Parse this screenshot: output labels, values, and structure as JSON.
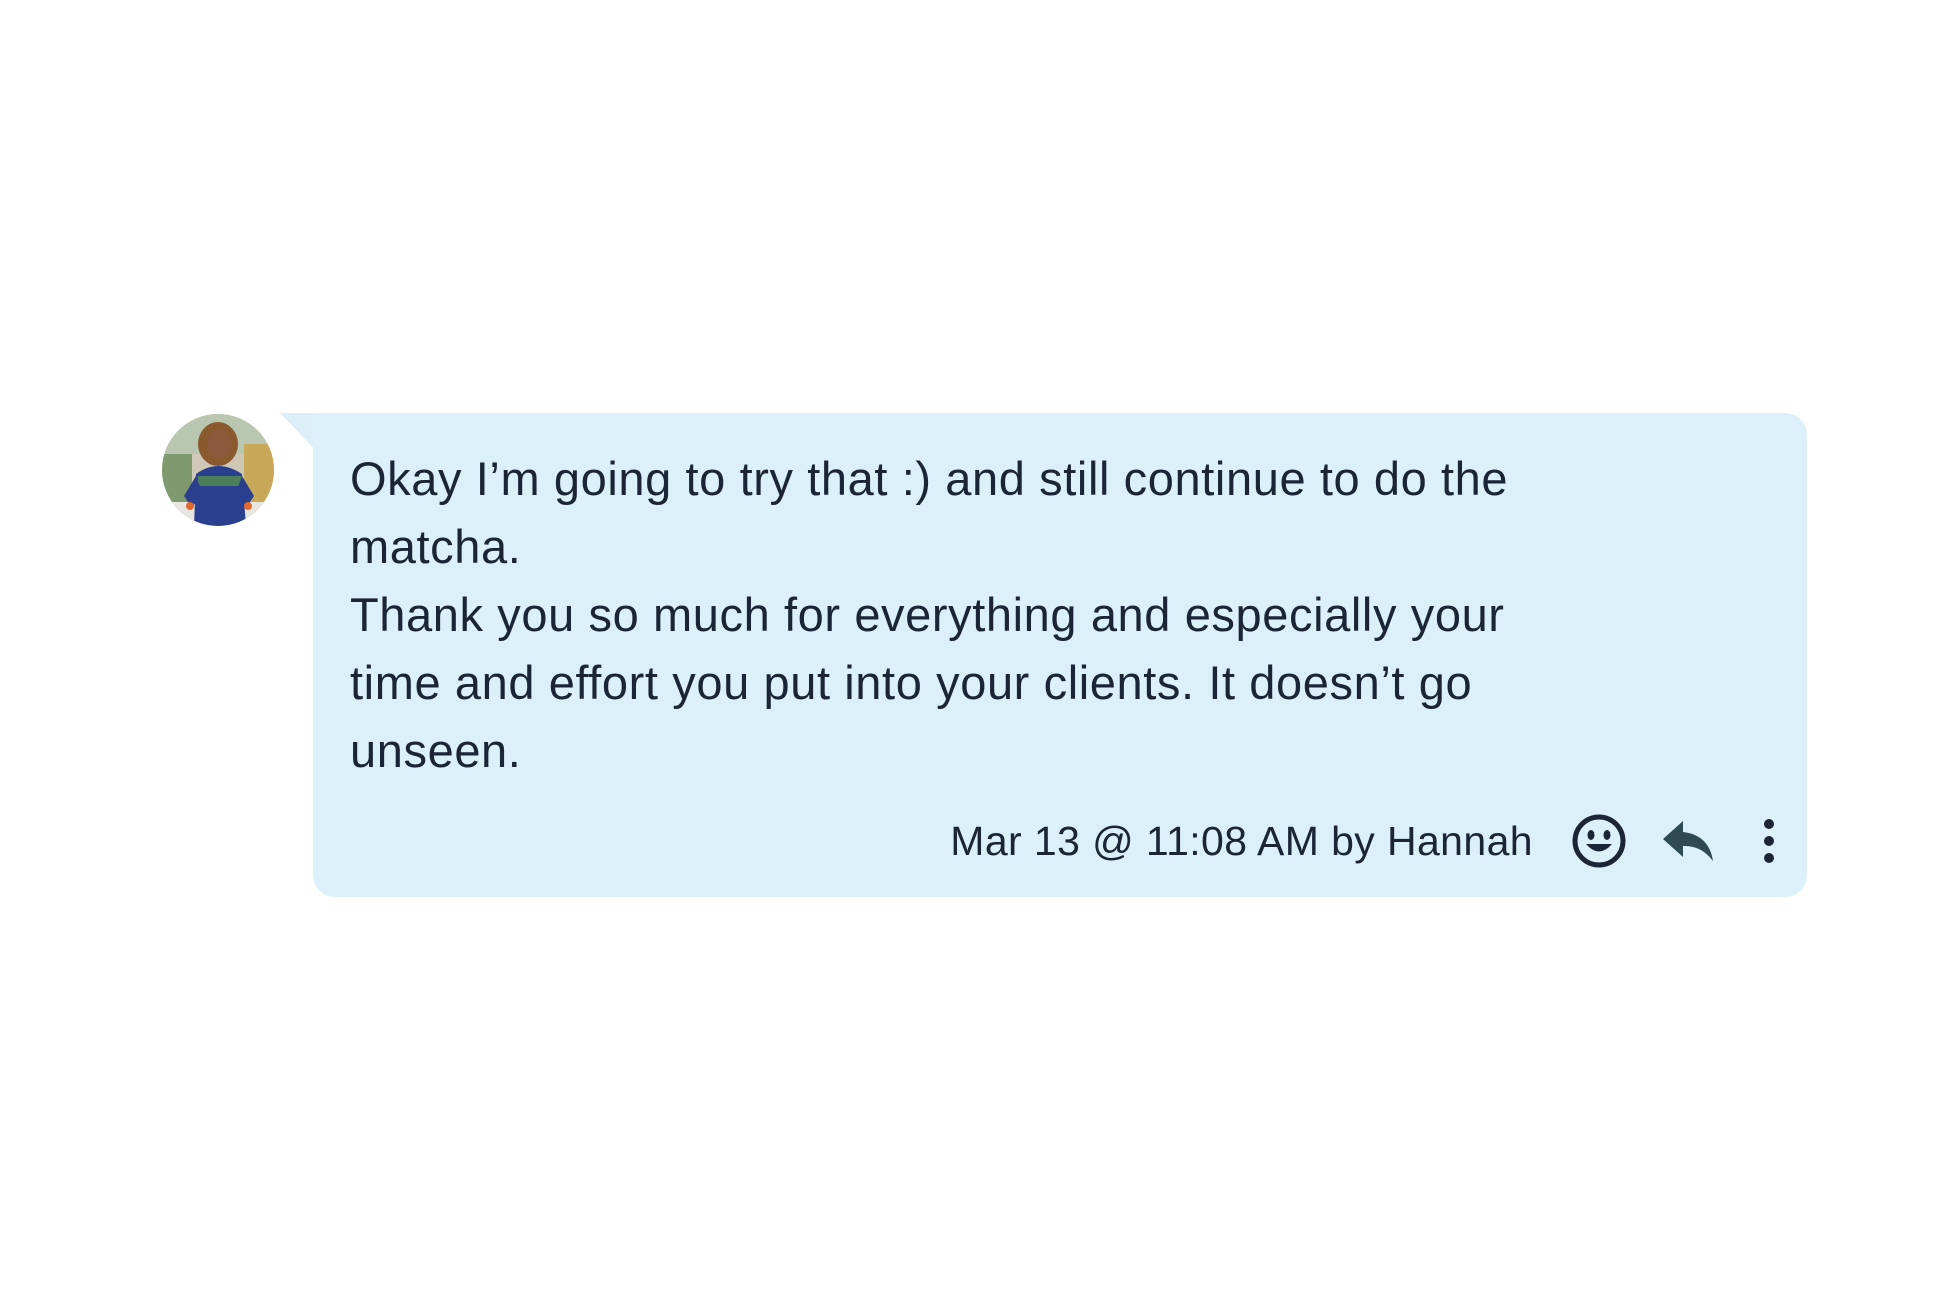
{
  "message": {
    "lines": [
      "Okay I’m going to try that :) and still continue to do the",
      "matcha.",
      "Thank you so much for everything and especially your",
      "time and effort you put into your clients. It doesn’t go",
      "unseen."
    ],
    "text": "Okay I’m going to try that :) and still continue to do the\nmatcha.\nThank you so much for everything and especially your\ntime and effort you put into your clients. It doesn’t go\nunseen.",
    "meta": "Mar 13 @ 11:08 AM by Hannah",
    "sender_avatar": "avatar-photo"
  },
  "actions": {
    "react_icon": "smiley-face-icon",
    "reply_icon": "reply-arrow-icon",
    "more_icon": "vertical-ellipsis-icon"
  },
  "colors": {
    "bubble": "#dcf0f9",
    "text": "#1b2536",
    "icon": "#1b2536",
    "reply_icon": "#2f4a52"
  }
}
